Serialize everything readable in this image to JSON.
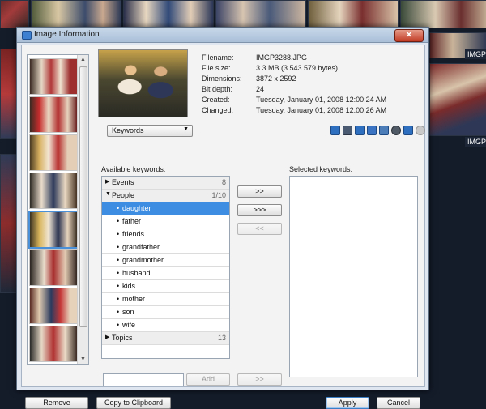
{
  "background": {
    "captions": [
      "IMGP",
      "IMGP"
    ]
  },
  "dialog": {
    "title": "Image Information",
    "close_icon": "close-icon",
    "info": [
      {
        "label": "Filename:",
        "value": "IMGP3288.JPG"
      },
      {
        "label": "File size:",
        "value": "3.3 MB (3 543 579 bytes)"
      },
      {
        "label": "Dimensions:",
        "value": "3872 x 2592"
      },
      {
        "label": "Bit depth:",
        "value": "24"
      },
      {
        "label": "Created:",
        "value": "Tuesday, January 01, 2008 12:00:24 AM"
      },
      {
        "label": "Changed:",
        "value": "Tuesday, January 01, 2008 12:00:26 AM"
      }
    ],
    "section_select": "Keywords",
    "toolbar_icons": [
      "info-icon",
      "camera-icon",
      "keyword-icon",
      "description-icon",
      "comment-icon",
      "rating-icon",
      "location-icon",
      "status-dot-icon"
    ],
    "available_label": "Available keywords:",
    "selected_label": "Selected keywords:",
    "tree": {
      "groups": [
        {
          "label": "Events",
          "count": "8",
          "expanded": false
        },
        {
          "label": "People",
          "count": "1/10",
          "expanded": true,
          "items": [
            "daughter",
            "father",
            "friends",
            "grandfather",
            "grandmother",
            "husband",
            "kids",
            "mother",
            "son",
            "wife"
          ],
          "selected_item": "daughter"
        },
        {
          "label": "Topics",
          "count": "13",
          "expanded": false
        }
      ]
    },
    "buttons": {
      "add_one": ">>",
      "add_all": ">>>",
      "remove": "<<",
      "add": "Add",
      "add_new": ">>",
      "remove_image": "Remove",
      "copy": "Copy to Clipboard",
      "apply": "Apply",
      "cancel": "Cancel"
    },
    "new_keyword_input": ""
  },
  "colors": {
    "selection": "#3d8ee3",
    "titlebar": "#b4c8de",
    "close": "#c94a33",
    "background": "#141c2a"
  }
}
